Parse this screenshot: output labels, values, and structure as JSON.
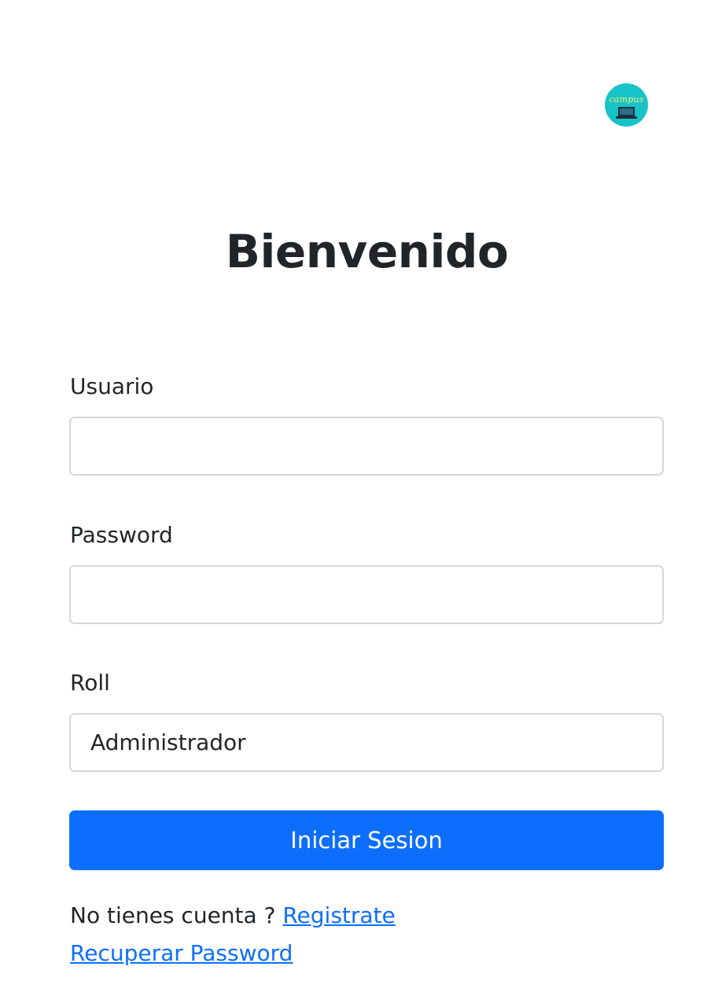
{
  "logo": {
    "text": "campus"
  },
  "heading": "Bienvenido",
  "form": {
    "usuario_label": "Usuario",
    "usuario_value": "",
    "password_label": "Password",
    "password_value": "",
    "roll_label": "Roll",
    "roll_selected": "Administrador",
    "submit_label": "Iniciar Sesion"
  },
  "footer": {
    "no_account_text": "No tienes cuenta ? ",
    "register_link": "Registrate",
    "recover_link": "Recuperar Password"
  },
  "colors": {
    "primary": "#0d6efd",
    "logo_bg": "#17c3c7",
    "text": "#212529"
  }
}
